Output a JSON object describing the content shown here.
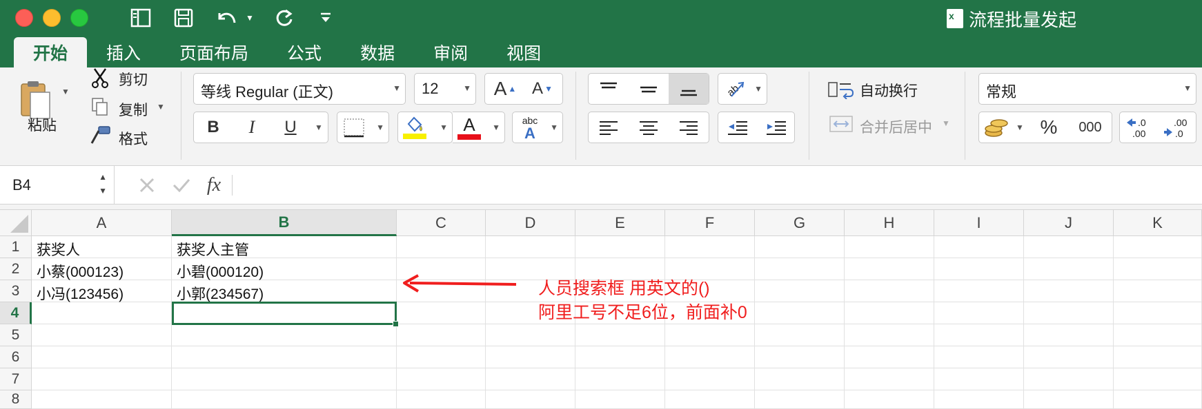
{
  "window": {
    "title": "流程批量发起"
  },
  "tabs": [
    "开始",
    "插入",
    "页面布局",
    "公式",
    "数据",
    "审阅",
    "视图"
  ],
  "ribbon": {
    "paste_label": "粘贴",
    "cut_label": "剪切",
    "copy_label": "复制",
    "format_painter_label": "格式",
    "font_name": "等线 Regular (正文)",
    "font_size": "12",
    "bold": "B",
    "italic": "I",
    "underline": "U",
    "wrap_text_label": "自动换行",
    "merge_center_label": "合并后居中",
    "number_format": "常规",
    "percent": "%",
    "thousands": "000",
    "font_color": "#e8101a",
    "fill_color": "#f8f000"
  },
  "formula_bar": {
    "name_box": "B4",
    "fx": "fx",
    "formula": ""
  },
  "sheet": {
    "columns": [
      "A",
      "B",
      "C",
      "D",
      "E",
      "F",
      "G",
      "H",
      "I",
      "J",
      "K"
    ],
    "selected_column": "B",
    "rows": [
      "1",
      "2",
      "3",
      "4",
      "5",
      "6",
      "7",
      "8"
    ],
    "selected_row": "4",
    "cells": {
      "A1": "获奖人",
      "B1": "获奖人主管",
      "A2": "小蔡(000123)",
      "B2": "小碧(000120)",
      "A3": "小冯(123456)",
      "B3": "小郭(234567)"
    }
  },
  "annotation": {
    "line1": "人员搜索框 用英文的()",
    "line2": "阿里工号不足6位，前面补0",
    "color": "#f01e1e"
  }
}
